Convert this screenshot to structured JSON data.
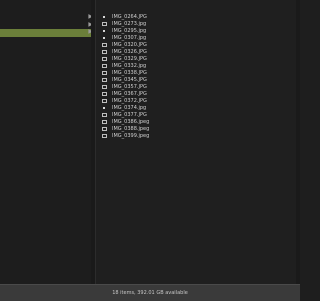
{
  "status": {
    "text": "18 items, 392.01 GB available"
  },
  "files": [
    {
      "name": "IMG_0264.JPG",
      "icon": "image-file-icon"
    },
    {
      "name": "IMG_0273.jpg",
      "icon": "image-file-icon"
    },
    {
      "name": "IMG_0295.jpg",
      "icon": "image-file-icon"
    },
    {
      "name": "IMG_0307.jpg",
      "icon": "image-file-icon"
    },
    {
      "name": "IMG_0320.JPG",
      "icon": "image-file-icon"
    },
    {
      "name": "IMG_0326.JPG",
      "icon": "image-file-icon"
    },
    {
      "name": "IMG_0329.JPG",
      "icon": "image-file-icon"
    },
    {
      "name": "IMG_0332.jpg",
      "icon": "image-file-icon"
    },
    {
      "name": "IMG_0338.JPG",
      "icon": "image-file-icon"
    },
    {
      "name": "IMG_0345.JPG",
      "icon": "image-file-icon"
    },
    {
      "name": "IMG_0357.JPG",
      "icon": "image-file-icon"
    },
    {
      "name": "IMG_0367.JPG",
      "icon": "image-file-icon"
    },
    {
      "name": "IMG_0372.JPG",
      "icon": "image-file-icon"
    },
    {
      "name": "IMG_0374.jpg",
      "icon": "image-file-icon"
    },
    {
      "name": "IMG_0377.JPG",
      "icon": "image-file-icon"
    },
    {
      "name": "IMG_0386.jpeg",
      "icon": "image-file-icon"
    },
    {
      "name": "IMG_0388.jpeg",
      "icon": "image-file-icon"
    },
    {
      "name": "IMG_0399.jpeg",
      "icon": "image-file-icon"
    }
  ],
  "colors": {
    "selection": "#6b7f3a",
    "status_bar": "#3a3a3a",
    "background": "#1e1e1e"
  }
}
